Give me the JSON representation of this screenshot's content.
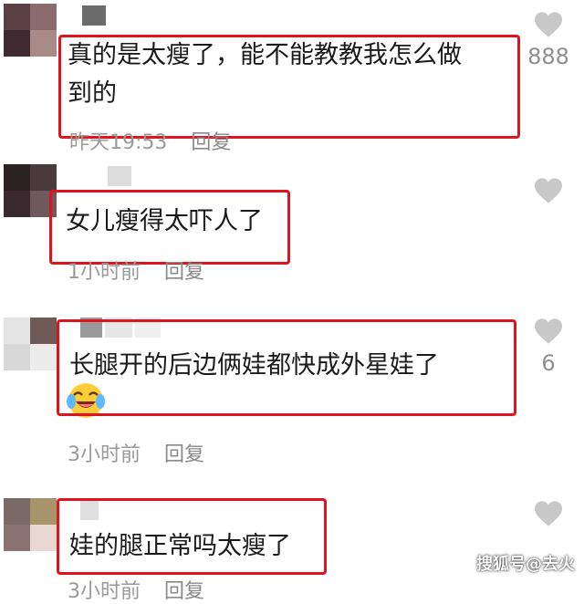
{
  "comments": [
    {
      "text_line1": "真的是太瘦了，能不能教教我怎么做",
      "text_line2": "到的",
      "time": "昨天19:53",
      "reply": "回复",
      "likes": "888"
    },
    {
      "text_line1": "女儿瘦得太吓人了",
      "time": "1小时前",
      "reply": "回复",
      "likes": ""
    },
    {
      "text_line1": "长腿开的后边俩娃都快成外星娃了",
      "emoji": "crying-laughing-emoji",
      "time": "3小时前",
      "reply": "回复",
      "likes": "6"
    },
    {
      "text_line1": "娃的腿正常吗太瘦了",
      "time": "3小时前",
      "reply": "回复",
      "likes": ""
    }
  ],
  "watermark": "搜狐号@去火",
  "colors": {
    "highlight_box": "#e0141e",
    "meta_text": "#9a9a9a",
    "like_icon": "#c8c8c8"
  }
}
